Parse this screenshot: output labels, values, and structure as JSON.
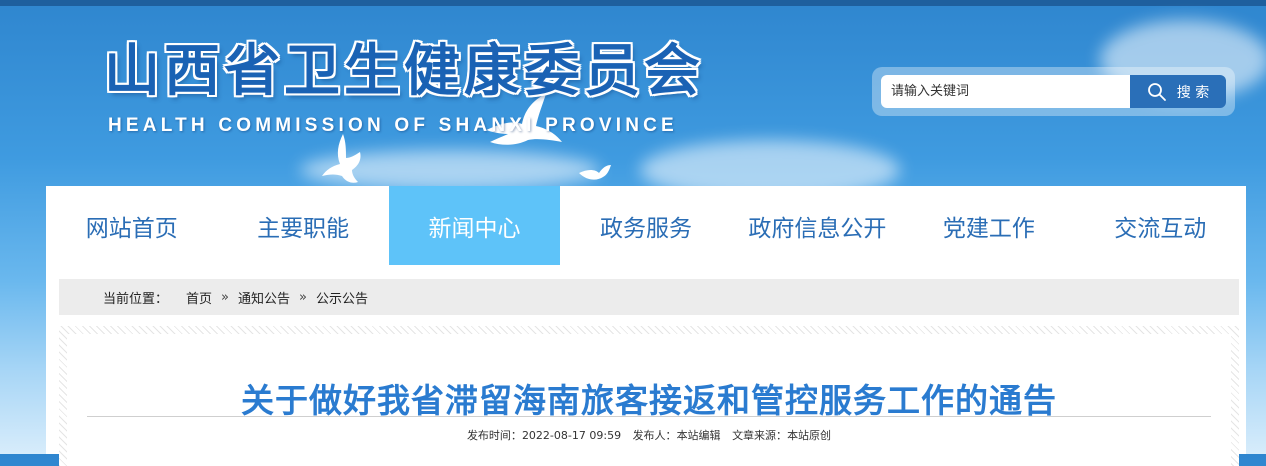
{
  "header": {
    "title": "山西省卫生健康委员会",
    "subtitle": "HEALTH COMMISSION OF SHANXI PROVINCE"
  },
  "search": {
    "placeholder": "请输入关键词",
    "button_label": "搜 索",
    "icon": "search-icon"
  },
  "nav": {
    "items": [
      {
        "label": "网站首页"
      },
      {
        "label": "主要职能"
      },
      {
        "label": "新闻中心"
      },
      {
        "label": "政务服务"
      },
      {
        "label": "政府信息公开"
      },
      {
        "label": "党建工作"
      },
      {
        "label": "交流互动"
      }
    ],
    "active": "新闻中心"
  },
  "breadcrumb": {
    "prefix": "当前位置：",
    "items": [
      "首页",
      "通知公告",
      "公示公告"
    ],
    "separator": "»"
  },
  "article": {
    "title": "关于做好我省滞留海南旅客接返和管控服务工作的通告",
    "publish_time_label": "发布时间：",
    "publish_time": "2022-08-17 09:59",
    "publisher_label": "发布人：",
    "publisher": "本站编辑",
    "source_label": "文章来源：",
    "source": "本站原创"
  },
  "colors": {
    "brand_blue": "#2a6db5",
    "nav_active_bg": "#5ec3f9",
    "title_blue": "#2a7bd0",
    "search_button": "#2a6fb8"
  }
}
